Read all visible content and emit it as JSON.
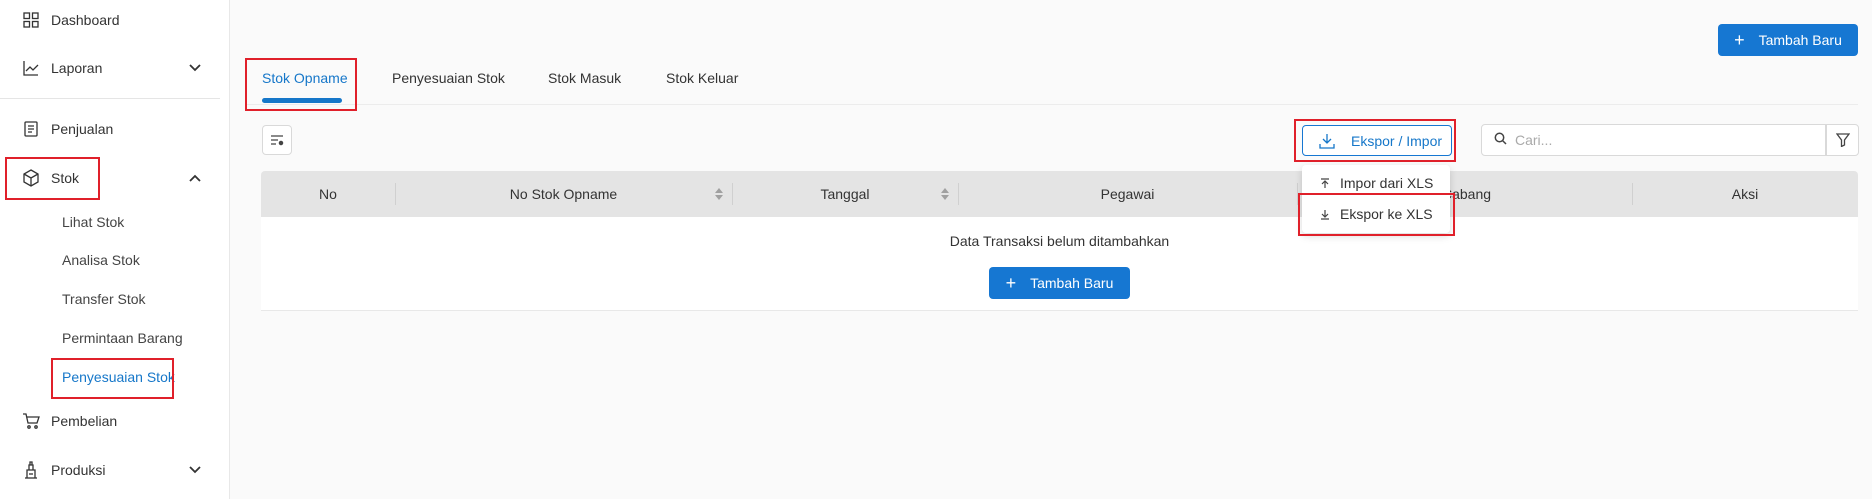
{
  "sidebar": {
    "items": [
      {
        "label": "Dashboard",
        "icon": "dashboard-grid-icon"
      },
      {
        "label": "Laporan",
        "icon": "line-chart-icon",
        "expanded": false
      },
      {
        "label": "Penjualan",
        "icon": "receipt-icon"
      },
      {
        "label": "Stok",
        "icon": "box-icon",
        "expanded": true
      },
      {
        "label": "Pembelian",
        "icon": "cart-icon"
      },
      {
        "label": "Produksi",
        "icon": "factory-icon",
        "expanded": false
      }
    ],
    "stok_sub_items": [
      "Lihat Stok",
      "Analisa Stok",
      "Transfer Stok",
      "Permintaan Barang",
      "Penyesuaian Stok"
    ],
    "active_sub_item": "Penyesuaian Stok"
  },
  "header": {
    "add_button_label": "Tambah Baru"
  },
  "tabs": [
    {
      "label": "Stok Opname",
      "active": true
    },
    {
      "label": "Penyesuaian Stok",
      "active": false
    },
    {
      "label": "Stok Masuk",
      "active": false
    },
    {
      "label": "Stok Keluar",
      "active": false
    }
  ],
  "toolbar": {
    "export_import_label": "Ekspor / Impor",
    "search_placeholder": "Cari..."
  },
  "export_menu": {
    "items": [
      "Impor dari XLS",
      "Ekspor ke XLS"
    ]
  },
  "table": {
    "columns": [
      "No",
      "No Stok Opname",
      "Tanggal",
      "Pegawai",
      "Cabang",
      "Aksi"
    ],
    "empty_message": "Data Transaksi belum ditambahkan",
    "add_button_label": "Tambah Baru"
  },
  "colors": {
    "accent": "#1677d2",
    "highlight": "#e0202a",
    "header_bg": "#e4e4e4"
  }
}
